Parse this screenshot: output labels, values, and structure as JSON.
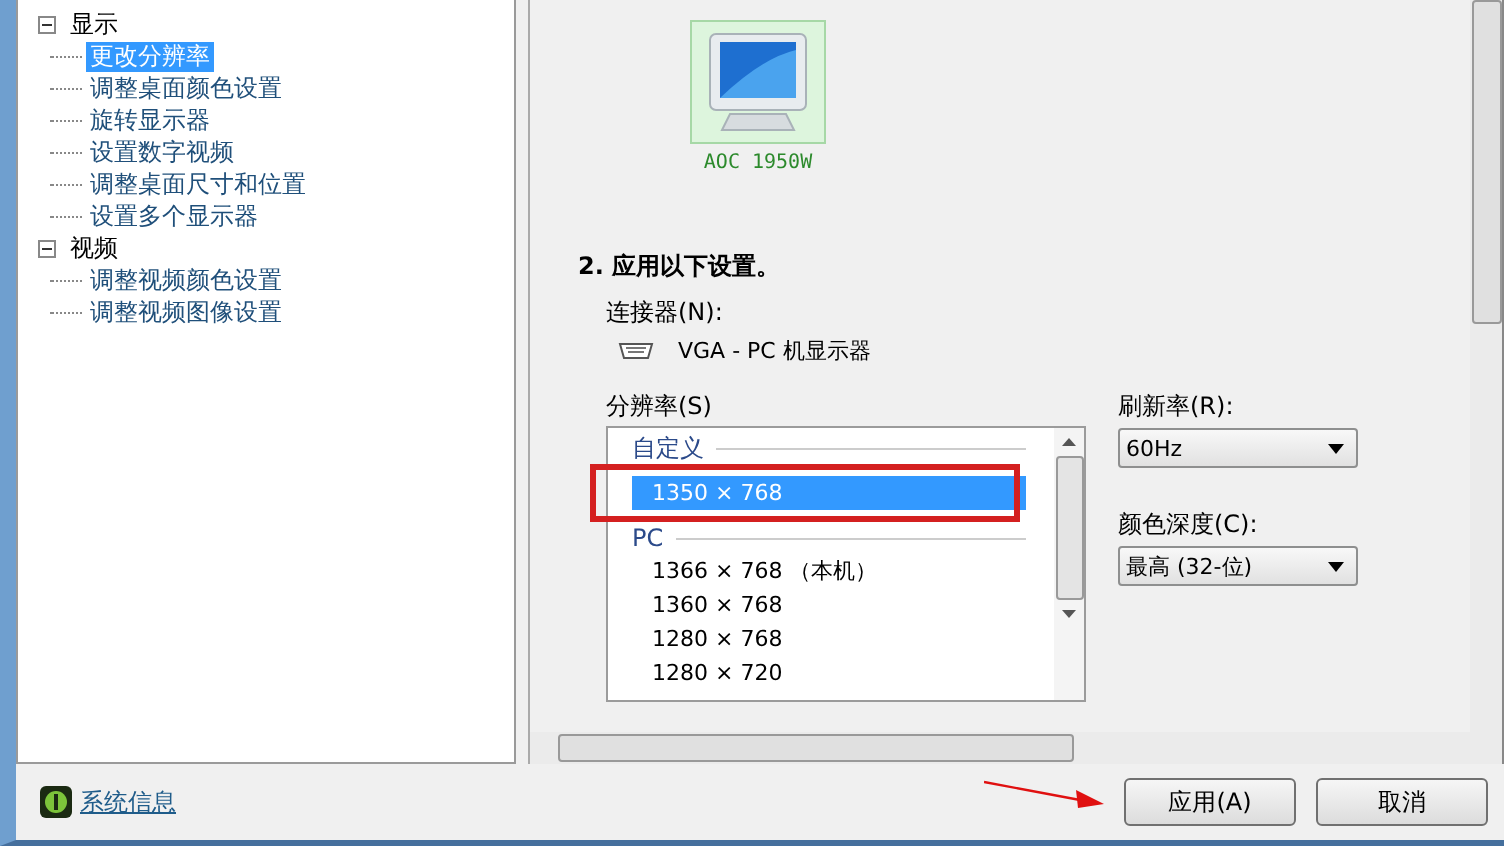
{
  "tree": [
    {
      "label": "显示",
      "expanded": true,
      "selected": false,
      "children": [
        {
          "label": "更改分辨率",
          "selected": true
        },
        {
          "label": "调整桌面颜色设置",
          "selected": false
        },
        {
          "label": "旋转显示器",
          "selected": false
        },
        {
          "label": "设置数字视频",
          "selected": false
        },
        {
          "label": "调整桌面尺寸和位置",
          "selected": false
        },
        {
          "label": "设置多个显示器",
          "selected": false
        }
      ]
    },
    {
      "label": "视频",
      "expanded": true,
      "selected": false,
      "children": [
        {
          "label": "调整视频颜色设置",
          "selected": false
        },
        {
          "label": "调整视频图像设置",
          "selected": false
        }
      ]
    }
  ],
  "display": {
    "name": "AOC 1950W",
    "selected": true
  },
  "section_heading": "2. 应用以下设置。",
  "connector": {
    "label": "连接器(N):",
    "value": "VGA - PC 机显示器"
  },
  "resolution": {
    "label": "分辨率(S)",
    "items": [
      {
        "kind": "group",
        "text": "自定义"
      },
      {
        "kind": "item",
        "text": "1350 × 768",
        "selected": true
      },
      {
        "kind": "group",
        "text": "PC"
      },
      {
        "kind": "item",
        "text": "1366 × 768 （本机）",
        "selected": false
      },
      {
        "kind": "item",
        "text": "1360 × 768",
        "selected": false
      },
      {
        "kind": "item",
        "text": "1280 × 768",
        "selected": false
      },
      {
        "kind": "item",
        "text": "1280 × 720",
        "selected": false
      }
    ]
  },
  "refresh_rate": {
    "label": "刷新率(R):",
    "value": "60Hz"
  },
  "color_depth": {
    "label": "颜色深度(C):",
    "value": "最高 (32-位)"
  },
  "system_info_link": "系统信息",
  "buttons": [
    {
      "label": "应用(A)"
    },
    {
      "label": "取消"
    }
  ]
}
